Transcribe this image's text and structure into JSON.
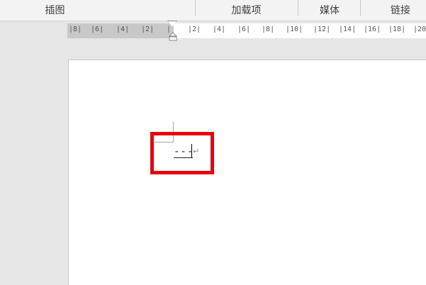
{
  "ribbon": {
    "groups": [
      {
        "label": "插图"
      },
      {
        "label": "加载项"
      },
      {
        "label": "媒体"
      },
      {
        "label": "链接"
      }
    ]
  },
  "ruler": {
    "left_labels": [
      "8",
      "6",
      "4",
      "2"
    ],
    "right_labels": [
      "2",
      "4",
      "6",
      "8",
      "10",
      "12",
      "14",
      "16",
      "18",
      "20"
    ]
  },
  "document": {
    "text": "---",
    "paragraph_mark": "↵"
  },
  "colors": {
    "highlight": "#e8000b",
    "ruler_margin": "#c8c8c8"
  }
}
